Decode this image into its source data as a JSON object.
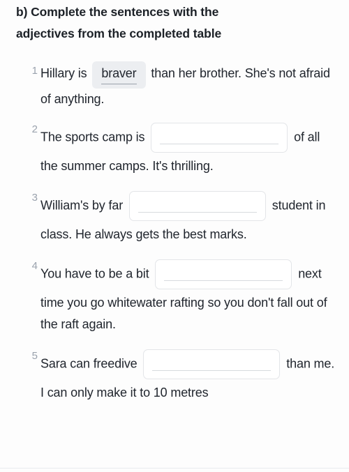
{
  "heading": {
    "line1": "b) Complete the sentences with the",
    "line2": "adjectives from the completed table"
  },
  "questions": [
    {
      "number": "1",
      "text_before": "Hillary is",
      "answer": "braver",
      "answer_filled": true,
      "text_after": "than her brother. She's not afraid of anything."
    },
    {
      "number": "2",
      "text_before": "The sports camp is",
      "answer": "",
      "answer_filled": false,
      "text_after": "of all the summer camps. It's thrilling."
    },
    {
      "number": "3",
      "text_before": "William's by far",
      "answer": "",
      "answer_filled": false,
      "text_after": "student in class. He always gets the best marks."
    },
    {
      "number": "4",
      "text_before": "You have to be a bit",
      "answer": "",
      "answer_filled": false,
      "text_after": "next time you go whitewater rafting so you don't fall out of the raft again."
    },
    {
      "number": "5",
      "text_before": "Sara can freedive",
      "answer": "",
      "answer_filled": false,
      "text_after": "than me. I can only make it to 10 metres"
    }
  ],
  "colors": {
    "text": "#21262e",
    "number": "#9aa2ad",
    "chip_bg": "#eceef1",
    "blank_border": "#e3e5e8",
    "page_bg": "#fdfdfd"
  }
}
